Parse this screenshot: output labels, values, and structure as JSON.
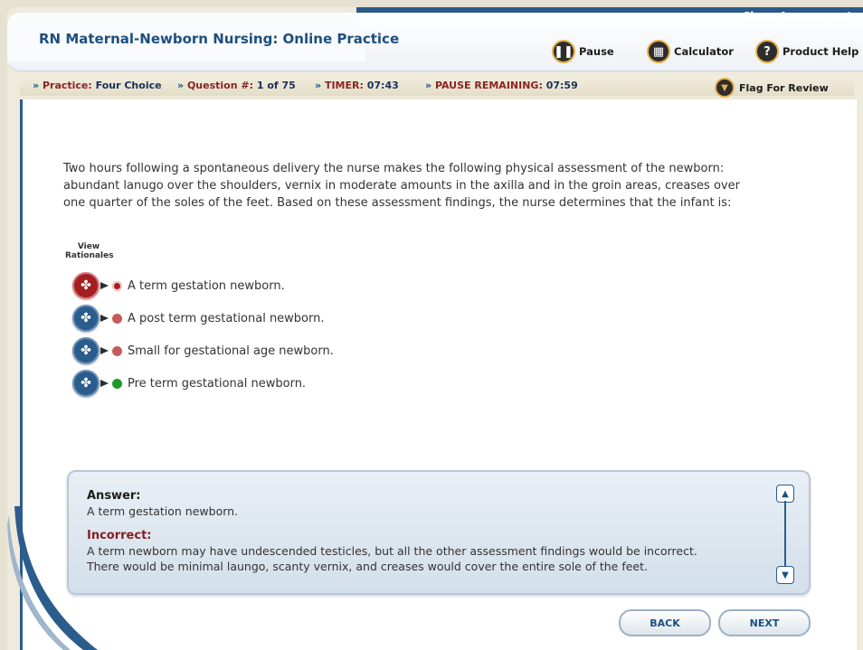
{
  "header": {
    "app_title": "RN Maternal-Newborn Nursing: Online Practice",
    "close_label": "Close Assessment",
    "pause_label": "Pause",
    "calculator_label": "Calculator",
    "help_label": "Product Help"
  },
  "status": {
    "practice_label": "Practice:",
    "practice_value": "Four Choice",
    "question_label": "Question #:",
    "question_value": "1 of 75",
    "timer_label": "TIMER:",
    "timer_value": "07:43",
    "pause_label": "PAUSE REMAINING:",
    "pause_value": "07:59",
    "flag_label": "Flag For Review"
  },
  "question": {
    "text": "Two hours following a spontaneous delivery the nurse makes the following physical assessment of the newborn: abundant lanugo over the shoulders, vernix in moderate amounts in the axilla and in the groin areas, creases over one quarter of the soles of the feet. Based on these assessment findings, the nurse determines that the infant is:",
    "view_rationales": "View Rationales",
    "options": [
      {
        "label": "A term gestation newborn.",
        "state": "selected"
      },
      {
        "label": "A post term gestational newborn.",
        "state": "incorrect"
      },
      {
        "label": "Small for gestational age newborn.",
        "state": "incorrect"
      },
      {
        "label": "Pre term gestational newborn.",
        "state": "correct"
      }
    ]
  },
  "answer": {
    "answer_heading": "Answer:",
    "answer_text": "A term gestation newborn.",
    "incorrect_heading": "Incorrect:",
    "incorrect_text_1": "A term newborn may have undescended testicles, but all the other assessment findings would be incorrect.",
    "incorrect_text_2": "There would be minimal laungo, scanty vernix, and creases would cover the entire sole of the feet."
  },
  "nav": {
    "back_label": "BACK",
    "next_label": "NEXT"
  },
  "colors": {
    "brand_blue": "#1c4f80",
    "selected_red": "#a41e22",
    "incorrect_dot": "#c75a5a",
    "correct_dot": "#1f9a2a"
  }
}
